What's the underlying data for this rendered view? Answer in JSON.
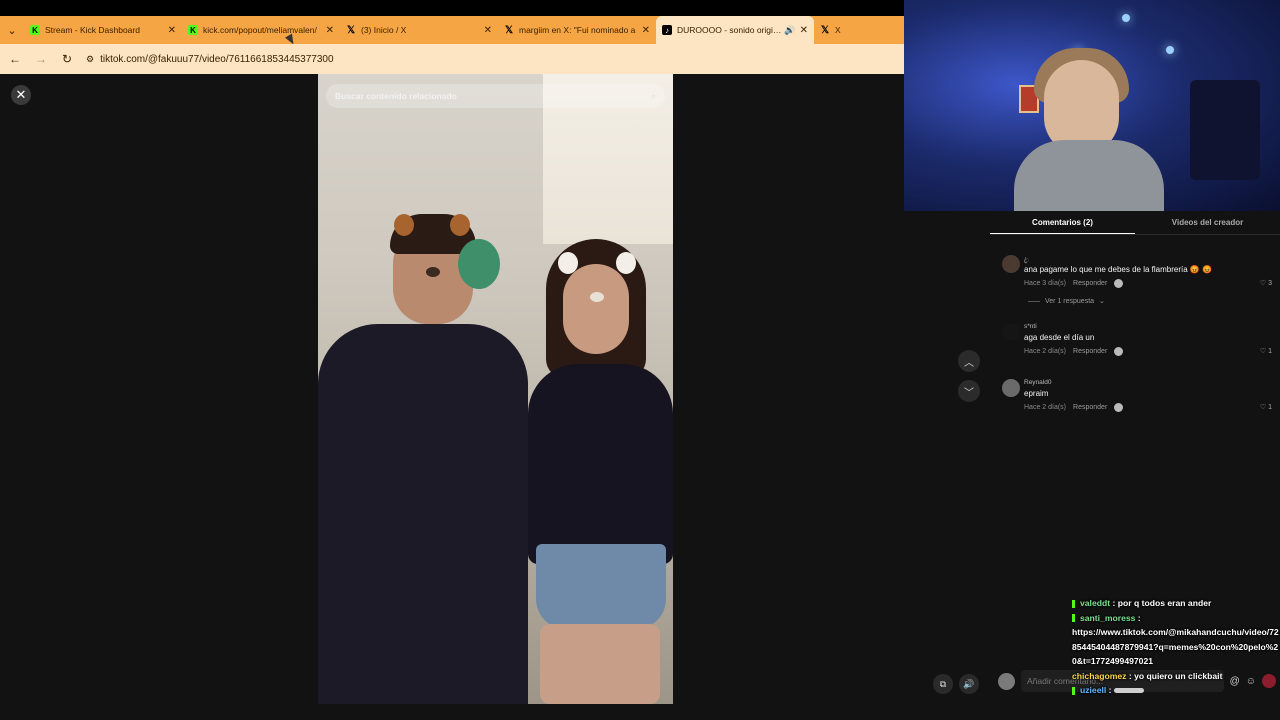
{
  "browser": {
    "tabs": [
      {
        "icon": "kick-icon",
        "title": "Stream - Kick Dashboard",
        "active": false
      },
      {
        "icon": "kick-icon",
        "title": "kick.com/popout/meliamvalen/",
        "active": false
      },
      {
        "icon": "x-icon",
        "title": "(3) Inicio / X",
        "active": false
      },
      {
        "icon": "x-icon",
        "title": "margiim en X: \"Fui nominado a",
        "active": false
      },
      {
        "icon": "tiktok-icon",
        "title": "DUROOOO - sonido origina",
        "active": true
      },
      {
        "icon": "x-icon",
        "title": "X",
        "active": false
      }
    ],
    "url": "tiktok.com/@fakuuu77/video/7611661853445377300"
  },
  "viewer": {
    "search_placeholder": "Buscar contenido relacionado"
  },
  "panel": {
    "tabs": [
      "Comentarios (2)",
      "Videos del creador"
    ],
    "comments": [
      {
        "user": "ꦿ",
        "text": "ana pagame lo que me debes de la flambrería 😡 😡",
        "time": "Hace 3 día(s)",
        "reply": "Responder",
        "likes": "3",
        "more": "Ver 1 respuesta"
      },
      {
        "user": "s*nti",
        "text": "aga desde el día un",
        "time": "Hace 2 día(s)",
        "reply": "Responder",
        "likes": "1"
      },
      {
        "user": "Reynald0",
        "text": "epraim",
        "time": "Hace 2 día(s)",
        "reply": "Responder",
        "likes": "1"
      }
    ],
    "comment_placeholder": "Añadir comentario..."
  },
  "chat": [
    {
      "user": "valeddt",
      "text": "por q todos eran ander"
    },
    {
      "user": "santi_moress",
      "text": "https://www.tiktok.com/@mikahandcuchu/video/7285445404487879941?q=memes%20con%20pelo%20&t=1772499497021"
    },
    {
      "user": "chichagomez",
      "text": "yo quiero un clickbait"
    },
    {
      "user": "uzieell",
      "text": ""
    }
  ],
  "colors": {
    "tabbar": "#f5a544",
    "addressbar": "#fde5c4",
    "kick_green": "#53fc18"
  }
}
